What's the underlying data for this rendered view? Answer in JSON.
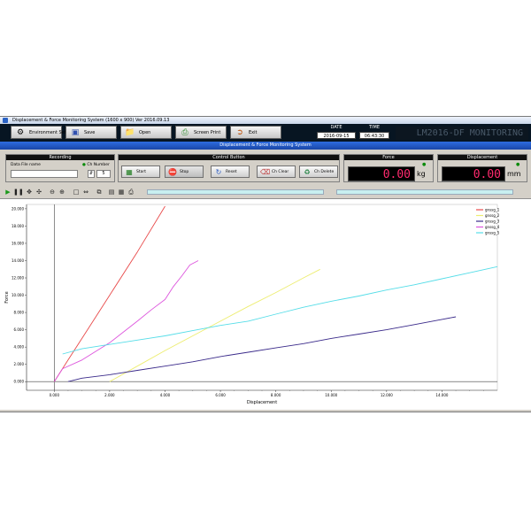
{
  "window": {
    "title": "Displacement  & Force Monitoring System (1600 x 900)  Ver 2016.09.13"
  },
  "toolbar": {
    "environment_set": "Environment Set",
    "save": "Save",
    "open": "Open",
    "screen_print": "Screen Print",
    "exit": "Exit",
    "date_label": "DATE",
    "date_value": "2016-09-15",
    "time_label": "TIME",
    "time_value": "06:43:30",
    "brand": "LM2016-DF MONITORING"
  },
  "main_title": "Displacement  &  Force  Monitoring  System",
  "recording": {
    "header": "Recording",
    "file_label": "Data File name",
    "file_value": "",
    "ch_label": "Ch Number",
    "ch_value": "5"
  },
  "control": {
    "header": "Control Button",
    "start": "Start",
    "stop": "Stop",
    "reset": "Reset",
    "ch_clear": "Ch Clear",
    "ch_delete": "Ch Delete"
  },
  "force": {
    "header": "Force",
    "value": "0.00",
    "unit": "kg"
  },
  "displacement": {
    "header": "Displacement",
    "value": "0.00",
    "unit": "mm"
  },
  "colors": {
    "readout": "#ff2a6e",
    "title_bar": "#1f55c0",
    "toolbar_bg": "#071522"
  },
  "chart_data": {
    "type": "line",
    "xlabel": "Displacement",
    "ylabel": "Force",
    "xlim": [
      -1.0,
      16.0
    ],
    "ylim": [
      -1.0,
      20.5
    ],
    "xticks": [
      "0.000",
      "2.000",
      "4.000",
      "6.000",
      "8.000",
      "10.000",
      "12.000",
      "14.000"
    ],
    "yticks": [
      "0.000",
      "2.000",
      "4.000",
      "6.000",
      "8.000",
      "10.000",
      "12.000",
      "14.000",
      "16.000",
      "18.000",
      "20.000"
    ],
    "legend_position": "top-right",
    "grid": false,
    "series": [
      {
        "name": "gnssg_1",
        "color": "#e84a4a",
        "x": [
          0.0,
          0.5,
          1.0,
          2.0,
          3.0,
          4.0
        ],
        "y": [
          0.0,
          2.5,
          5.0,
          10.0,
          15.0,
          20.3
        ]
      },
      {
        "name": "gnssg_2",
        "color": "#eded70",
        "x": [
          2.0,
          3.0,
          4.0,
          5.0,
          6.0,
          7.0,
          8.0,
          9.0,
          9.6
        ],
        "y": [
          0.0,
          1.8,
          3.6,
          5.3,
          7.0,
          8.7,
          10.3,
          12.0,
          13.0
        ]
      },
      {
        "name": "gnssg_3",
        "color": "#3a2a8a",
        "x": [
          0.5,
          1.0,
          2.0,
          3.0,
          4.0,
          5.0,
          6.0,
          7.0,
          8.0,
          9.0,
          10.0,
          11.0,
          12.0,
          13.0,
          14.0,
          14.5
        ],
        "y": [
          0.0,
          0.4,
          0.8,
          1.3,
          1.8,
          2.3,
          2.9,
          3.4,
          3.9,
          4.4,
          5.0,
          5.5,
          6.0,
          6.6,
          7.2,
          7.5
        ]
      },
      {
        "name": "gnssg_4",
        "color": "#dd55dd",
        "x": [
          0.0,
          0.3,
          1.0,
          2.0,
          3.0,
          3.5,
          4.0,
          4.3,
          4.6,
          4.9,
          5.2
        ],
        "y": [
          0.0,
          1.5,
          2.5,
          4.5,
          7.0,
          8.3,
          9.5,
          11.0,
          12.2,
          13.5,
          14.0
        ]
      },
      {
        "name": "gnssg_5",
        "color": "#55dde8",
        "x": [
          0.3,
          1.0,
          2.0,
          3.0,
          4.0,
          5.0,
          6.0,
          7.0,
          8.0,
          9.0,
          10.0,
          11.0,
          12.0,
          13.0,
          14.0,
          15.0,
          16.0
        ],
        "y": [
          3.2,
          3.8,
          4.3,
          4.8,
          5.3,
          5.9,
          6.5,
          7.0,
          7.8,
          8.6,
          9.3,
          9.9,
          10.6,
          11.2,
          11.9,
          12.6,
          13.3
        ]
      }
    ]
  }
}
